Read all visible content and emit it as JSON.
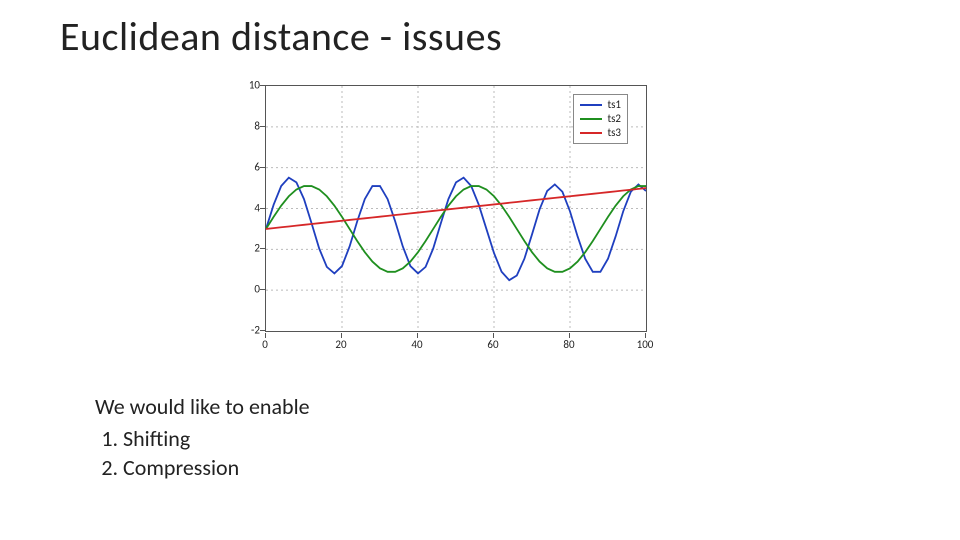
{
  "title": "Euclidean distance - issues",
  "body": {
    "intro": "We would like to enable",
    "items": [
      "Shifting",
      "Compression"
    ]
  },
  "chart_data": {
    "type": "line",
    "title": "",
    "xlabel": "",
    "ylabel": "",
    "xlim": [
      0,
      100
    ],
    "ylim": [
      -2,
      10
    ],
    "x_ticks": [
      0,
      20,
      40,
      60,
      80,
      100
    ],
    "y_ticks": [
      -2,
      0,
      2,
      4,
      6,
      8,
      10
    ],
    "grid": true,
    "legend_position": "upper right",
    "x": [
      0,
      2,
      4,
      6,
      8,
      10,
      12,
      14,
      16,
      18,
      20,
      22,
      24,
      26,
      28,
      30,
      32,
      34,
      36,
      38,
      40,
      42,
      44,
      46,
      48,
      50,
      52,
      54,
      56,
      58,
      60,
      62,
      64,
      66,
      68,
      70,
      72,
      74,
      76,
      78,
      80,
      82,
      84,
      86,
      88,
      90,
      92,
      94,
      96,
      98,
      100
    ],
    "series": [
      {
        "name": "ts1",
        "color": "#1f3fbf",
        "values": [
          3.0,
          4.18,
          5.1,
          5.51,
          5.28,
          4.46,
          3.27,
          2.04,
          1.14,
          0.82,
          1.18,
          2.14,
          3.37,
          4.46,
          5.1,
          5.1,
          4.46,
          3.37,
          2.14,
          1.18,
          0.82,
          1.14,
          2.04,
          3.27,
          4.46,
          5.28,
          5.51,
          5.1,
          4.18,
          3.0,
          1.82,
          0.9,
          0.49,
          0.72,
          1.54,
          2.73,
          3.96,
          4.86,
          5.18,
          4.82,
          3.86,
          2.63,
          1.54,
          0.9,
          0.9,
          1.54,
          2.63,
          3.86,
          4.82,
          5.18,
          4.86
        ]
      },
      {
        "name": "ts2",
        "color": "#1f8f1f",
        "values": [
          3.0,
          3.59,
          4.14,
          4.6,
          4.93,
          5.1,
          5.1,
          4.93,
          4.6,
          4.14,
          3.59,
          3.0,
          2.41,
          1.86,
          1.4,
          1.07,
          0.9,
          0.9,
          1.07,
          1.4,
          1.86,
          2.41,
          3.0,
          3.59,
          4.14,
          4.6,
          4.93,
          5.1,
          5.1,
          4.93,
          4.6,
          4.14,
          3.59,
          3.0,
          2.41,
          1.86,
          1.4,
          1.07,
          0.9,
          0.9,
          1.07,
          1.4,
          1.86,
          2.41,
          3.0,
          3.59,
          4.14,
          4.6,
          4.93,
          5.1,
          5.1
        ]
      },
      {
        "name": "ts3",
        "color": "#d62728",
        "values": [
          3.0,
          3.04,
          3.08,
          3.12,
          3.16,
          3.2,
          3.24,
          3.28,
          3.32,
          3.36,
          3.4,
          3.44,
          3.48,
          3.52,
          3.56,
          3.6,
          3.64,
          3.68,
          3.72,
          3.76,
          3.8,
          3.84,
          3.88,
          3.92,
          3.96,
          4.0,
          4.04,
          4.08,
          4.12,
          4.16,
          4.2,
          4.24,
          4.28,
          4.32,
          4.36,
          4.4,
          4.44,
          4.48,
          4.52,
          4.56,
          4.6,
          4.64,
          4.68,
          4.72,
          4.76,
          4.8,
          4.84,
          4.88,
          4.92,
          4.96,
          5.0
        ]
      }
    ]
  }
}
